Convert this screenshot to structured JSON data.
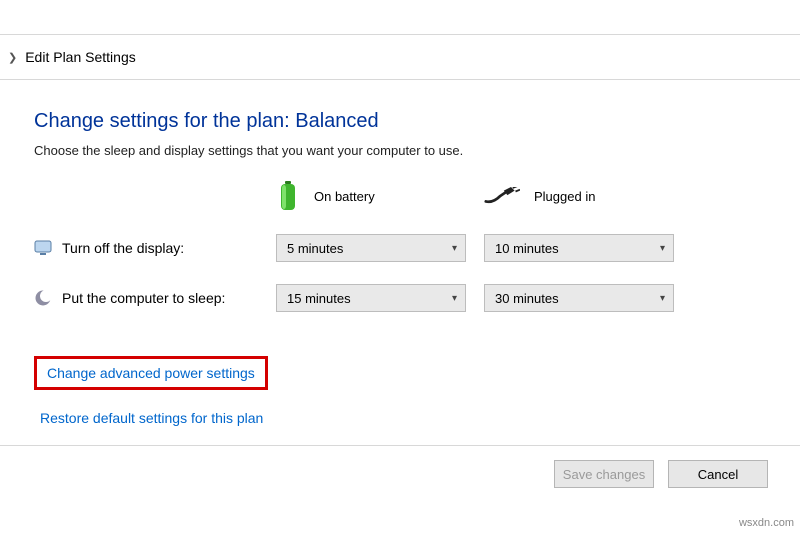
{
  "breadcrumb": {
    "title": "Edit Plan Settings"
  },
  "page": {
    "heading": "Change settings for the plan: Balanced",
    "subtext": "Choose the sleep and display settings that you want your computer to use."
  },
  "columns": {
    "battery": "On battery",
    "plugged": "Plugged in"
  },
  "rows": {
    "display": {
      "label": "Turn off the display:",
      "battery": "5 minutes",
      "plugged": "10 minutes"
    },
    "sleep": {
      "label": "Put the computer to sleep:",
      "battery": "15 minutes",
      "plugged": "30 minutes"
    }
  },
  "links": {
    "advanced": "Change advanced power settings",
    "restore": "Restore default settings for this plan"
  },
  "buttons": {
    "save": "Save changes",
    "cancel": "Cancel"
  },
  "watermark": "wsxdn.com"
}
